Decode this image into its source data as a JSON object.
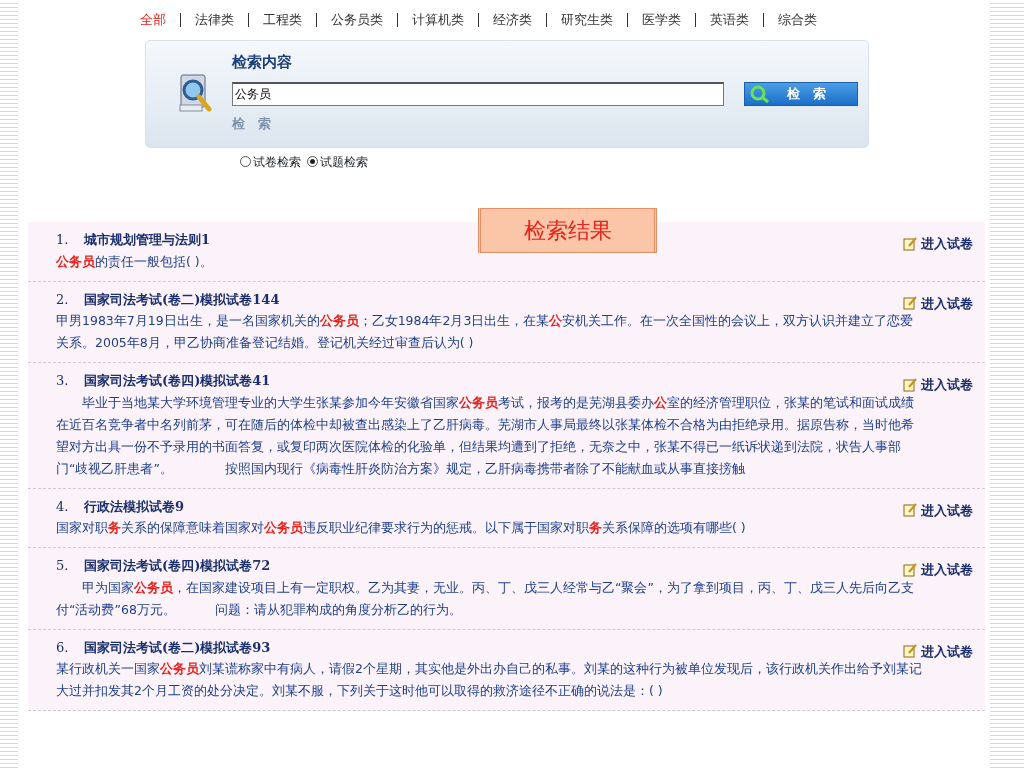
{
  "nav": [
    {
      "label": "全部",
      "selected": true
    },
    {
      "label": "法律类",
      "selected": false
    },
    {
      "label": "工程类",
      "selected": false
    },
    {
      "label": "公务员类",
      "selected": false
    },
    {
      "label": "计算机类",
      "selected": false
    },
    {
      "label": "经济类",
      "selected": false
    },
    {
      "label": "研究生类",
      "selected": false
    },
    {
      "label": "医学类",
      "selected": false
    },
    {
      "label": "英语类",
      "selected": false
    },
    {
      "label": "综合类",
      "selected": false
    }
  ],
  "search": {
    "heading": "检索内容",
    "value": "公务员",
    "button": "检　索",
    "sub_label": "检　索"
  },
  "modes": [
    {
      "label": "试卷检索",
      "selected": false
    },
    {
      "label": "试题检索",
      "selected": true
    }
  ],
  "results_title": "检索结果",
  "results": [
    {
      "number": "1.",
      "title": "城市规划管理与法则1",
      "text": "**公务员**的责任一般包括( )。",
      "action": "进入试卷"
    },
    {
      "number": "2.",
      "title": "国家司法考试(卷二)模拟试卷144",
      "text": "甲男1983年7月19日出生，是一名国家机关的**公务员**；乙女1984年2月3日出生，在某**公**安机关工作。在一次全国性的会议上，双方认识并建立了恋爱关系。2005年8月，甲乙协商准备登记结婚。登记机关经过审查后认为( )",
      "action": "进入试卷"
    },
    {
      "number": "3.",
      "title": "国家司法考试(卷四)模拟试卷41",
      "text": "　　毕业于当地某大学环境管理专业的大学生张某参加今年安徽省国家**公务员**考试，报考的是芜湖县委办**公**室的经济管理职位，张某的笔试和面试成绩在近百名竞争者中名列前茅，可在随后的体检中却被查出感染上了乙肝病毒。芜湖市人事局最终以张某体检不合格为由拒绝录用。据原告称，当时他希望对方出具一份不予录用的书面答复，或复印两次医院体检的化验单，但结果均遭到了拒绝，无奈之中，张某不得已一纸诉状递到法院，状告人事部门“歧视乙肝患者”。　　　　按照国内现行《病毒性肝炎防治方案》规定，乙肝病毒携带者除了不能献血或从事直接搒触",
      "action": "进入试卷"
    },
    {
      "number": "4.",
      "title": "行政法模拟试卷9",
      "text": "国家对职**务**关系的保障意味着国家对**公务员**违反职业纪律要求行为的惩戒。以下属于国家对职**务**关系保障的选项有哪些( )",
      "action": "进入试卷"
    },
    {
      "number": "5.",
      "title": "国家司法考试(卷四)模拟试卷72",
      "text": "　　甲为国家**公务员**，在国家建设项目上有一定职权。乙为其妻，无业。丙、丁、戊三人经常与乙“聚会”，为了拿到项目，丙、丁、戊三人先后向乙支付“活动费”68万元。　　　问题：请从犯罪构成的角度分析乙的行为。",
      "action": "进入试卷"
    },
    {
      "number": "6.",
      "title": "国家司法考试(卷二)模拟试卷93",
      "text": "某行政机关一国家**公务员**刘某谎称家中有病人，请假2个星期，其实他是外出办自己的私事。刘某的这种行为被单位发现后，该行政机关作出给予刘某记大过并扣发其2个月工资的处分决定。刘某不服，下列关于这时他可以取得的救济途径不正确的说法是：( )",
      "action": "进入试卷"
    }
  ]
}
